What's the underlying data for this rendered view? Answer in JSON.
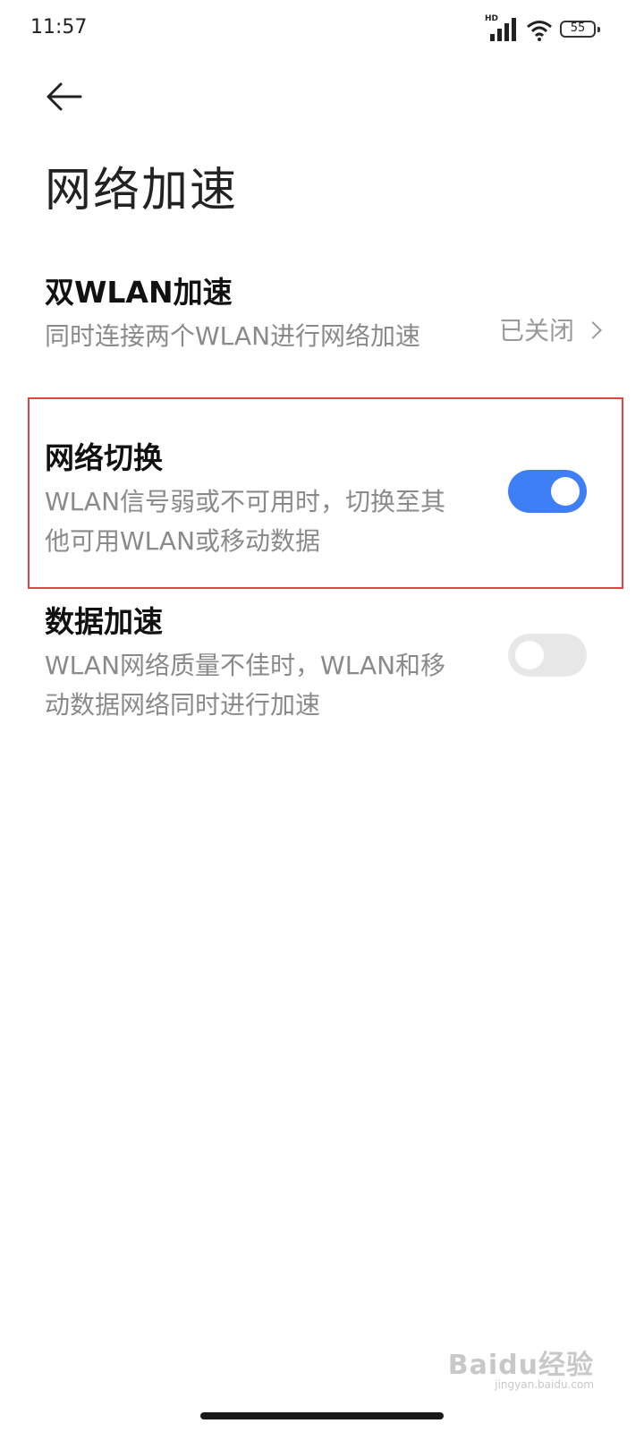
{
  "status_bar": {
    "time": "11:57",
    "hd_label": "HD",
    "battery": "55"
  },
  "header": {
    "title": "网络加速"
  },
  "settings": {
    "dual_wlan": {
      "title": "双WLAN加速",
      "description": "同时连接两个WLAN进行网络加速",
      "value": "已关闭"
    },
    "network_switch": {
      "title": "网络切换",
      "description": "WLAN信号弱或不可用时，切换至其他可用WLAN或移动数据",
      "enabled": true
    },
    "data_acceleration": {
      "title": "数据加速",
      "description": "WLAN网络质量不佳时，WLAN和移动数据网络同时进行加速",
      "enabled": false
    }
  },
  "watermark": {
    "text": "Baidu经验",
    "sub": "jingyan.baidu.com"
  },
  "colors": {
    "toggle_on": "#3e7ff6",
    "toggle_off": "#e7e7e7",
    "highlight": "#e04444"
  }
}
